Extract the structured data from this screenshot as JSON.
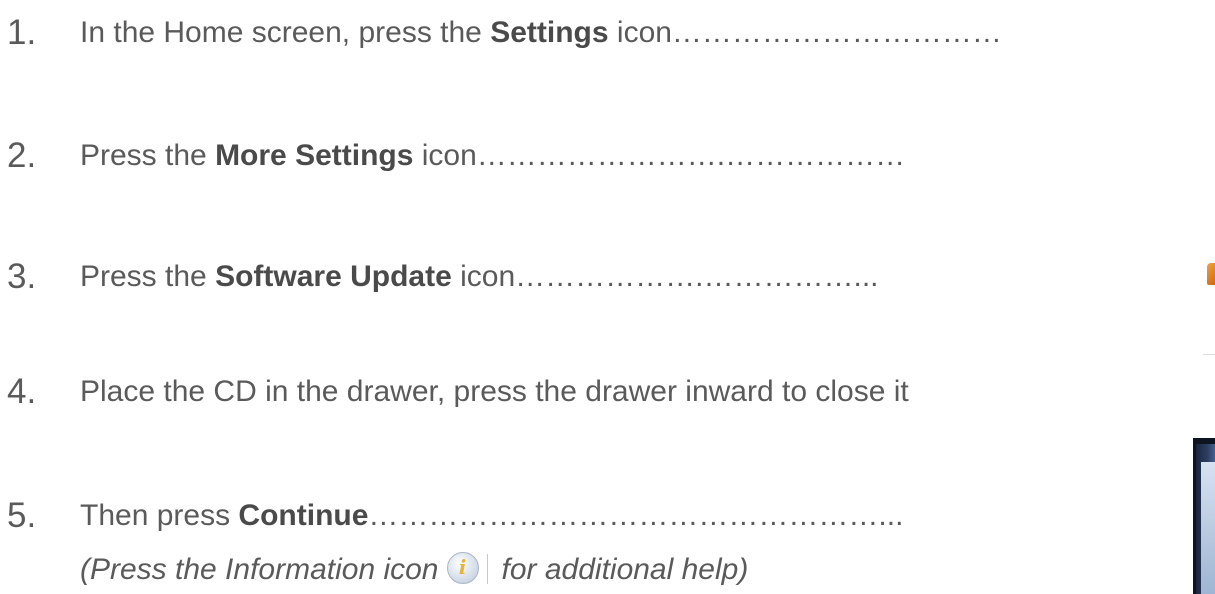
{
  "steps": [
    {
      "number": "1.",
      "prefix": "In the Home screen, press the ",
      "bold": "Settings",
      "suffix": " icon……………………………"
    },
    {
      "number": "2.",
      "prefix": "Press the ",
      "bold": "More Settings",
      "suffix": " icon…………………….………………"
    },
    {
      "number": "3.",
      "prefix": "Press the ",
      "bold": "Software Update",
      "suffix": " icon……………….……………..."
    },
    {
      "number": "4.",
      "prefix": "Place the CD in the drawer, press the drawer inward to close it",
      "bold": "",
      "suffix": ""
    },
    {
      "number": "5.",
      "prefix": "Then press ",
      "bold": "Continue",
      "suffix": "……………………………………………..."
    }
  ],
  "note": {
    "before": "(Press the Information icon",
    "after": "for additional help)",
    "icon": "information-icon"
  },
  "colors": {
    "text": "#5a5a5a",
    "info_glyph": "#e3b43a"
  }
}
